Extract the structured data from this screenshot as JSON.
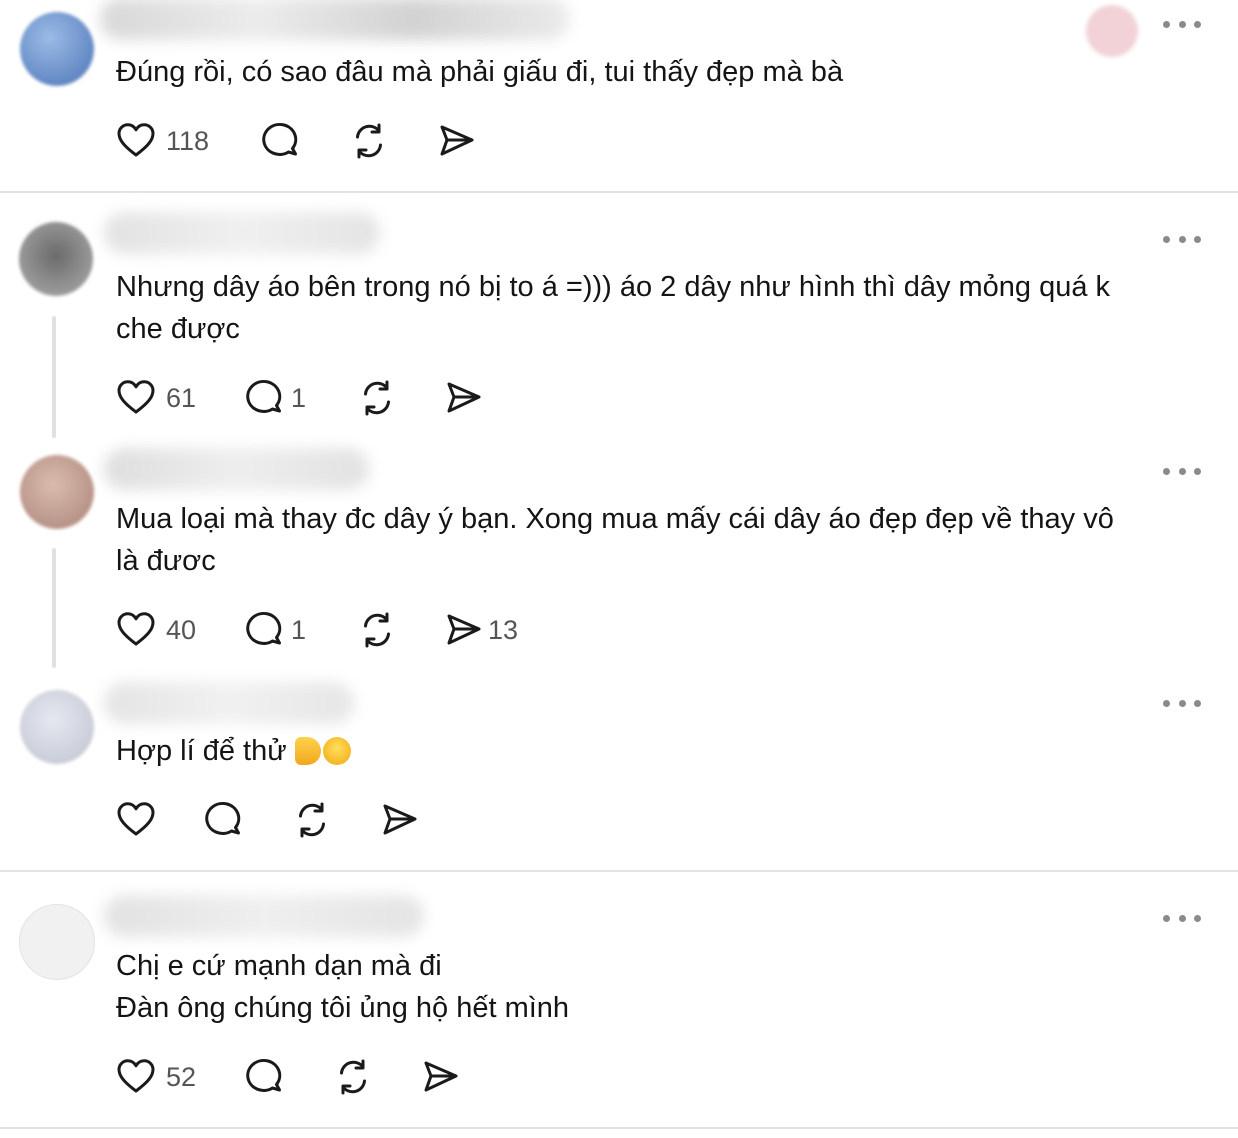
{
  "comments": [
    {
      "text_lines": [
        "Đúng rồi, có sao đâu mà phải giấu đi, tui thấy đẹp mà bà"
      ],
      "likes": "118",
      "replies": "",
      "shares": ""
    },
    {
      "text_lines": [
        "Nhưng dây áo bên trong nó bị to á =))) áo 2 dây như hình thì dây mỏng quá k",
        "che được"
      ],
      "likes": "61",
      "replies": "1",
      "shares": ""
    },
    {
      "text_lines": [
        "Mua loại mà thay đc dây ý bạn. Xong mua mấy cái dây áo đẹp đẹp về thay vô",
        "là đươc"
      ],
      "likes": "40",
      "replies": "1",
      "shares": "13"
    },
    {
      "text_lines": [
        "Hợp lí để thử "
      ],
      "emoji": [
        "thumbs-up",
        "grinning-squinting-face"
      ],
      "likes": "",
      "replies": "",
      "shares": ""
    },
    {
      "text_lines": [
        "Chị e cứ mạnh dạn mà đi",
        "Đàn ông chúng tôi ủng hộ hết mình"
      ],
      "likes": "52",
      "replies": "",
      "shares": ""
    }
  ],
  "icons": [
    "like-icon",
    "reply-icon",
    "repost-icon",
    "share-icon",
    "more-icon"
  ],
  "colors": {
    "icon": "#1a1a1a",
    "count": "#555555",
    "divider": "#e3e3e3",
    "thread_line": "#e1e1e1"
  }
}
